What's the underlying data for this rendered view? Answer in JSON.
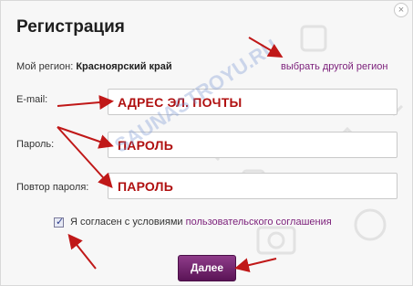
{
  "dialog": {
    "title": "Регистрация",
    "close_symbol": "×"
  },
  "region": {
    "label": "Мой регион:",
    "value": "Красноярский край",
    "change_link": "выбрать другой регион"
  },
  "form": {
    "email_label": "E-mail:",
    "email_value": "АДРЕС ЭЛ. ПОЧТЫ",
    "password_label": "Пароль:",
    "password_value": "ПАРОЛЬ",
    "repeat_label": "Повтор пароля:",
    "repeat_value": "ПАРОЛЬ"
  },
  "agreement": {
    "checked": true,
    "text": "Я согласен с условиями",
    "link": "пользовательского соглашения"
  },
  "submit_label": "Далее",
  "watermark": "SAUNASTROYU.RU",
  "colors": {
    "accent": "#7b1f7a",
    "field_text": "#b01010",
    "arrow": "#c01818"
  }
}
